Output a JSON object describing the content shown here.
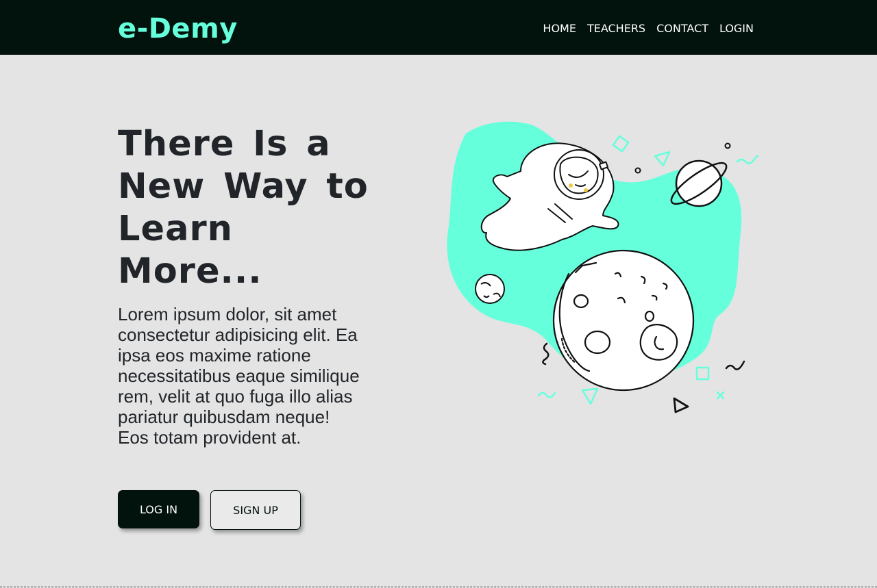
{
  "navbar": {
    "brand": "e-Demy",
    "links": [
      {
        "label": "HOME"
      },
      {
        "label": "TEACHERS"
      },
      {
        "label": "CONTACT"
      },
      {
        "label": "LOGIN"
      }
    ]
  },
  "hero": {
    "title": "There Is a New Way to Learn More...",
    "text": "Lorem ipsum dolor, sit amet consectetur adipisicing elit. Ea ipsa eos maxime ratione necessitatibus eaque similique rem, velit at quo fuga illo alias pariatur quibusdam neque! Eos totam provident at.",
    "login_button": "LOG IN",
    "signup_button": "SIGN UP"
  },
  "colors": {
    "navbar_bg": "#02120c",
    "brand": "#66ffdc",
    "accent": "#66ffdc",
    "page_bg": "#e4e4e4",
    "text": "#212529"
  },
  "illustration": {
    "icons": [
      "astronaut-icon",
      "moon-icon",
      "saturn-planet-icon",
      "small-planet-icon"
    ]
  }
}
